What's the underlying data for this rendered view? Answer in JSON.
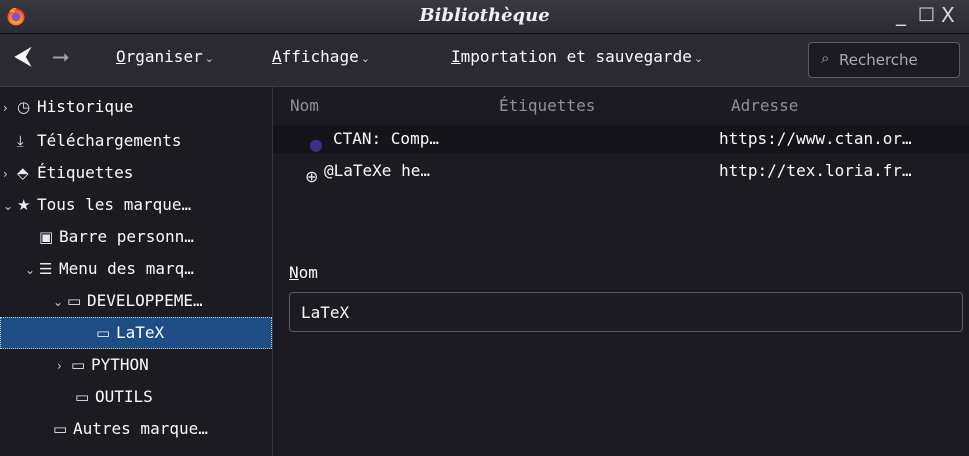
{
  "window": {
    "title": "Bibliothèque",
    "controls": {
      "minimize": "_",
      "maximize": "□",
      "close": "X"
    }
  },
  "toolbar": {
    "back": "⮜",
    "forward": "⭢",
    "organiser_prefix": "O",
    "organiser_rest": "rganiser",
    "affichage_prefix": "A",
    "affichage_rest": "ffichage",
    "import_prefix": "I",
    "import_rest": "mportation et sauvegarde",
    "caret": "⌄",
    "search_placeholder": "Recherche",
    "search_icon": "⌕"
  },
  "sidebar": {
    "items": [
      {
        "twisty": "›",
        "icon": "◷",
        "label": "Historique"
      },
      {
        "twisty": "",
        "icon": "⤓",
        "label": "Téléchargements"
      },
      {
        "twisty": "›",
        "icon": "⬘",
        "label": "Étiquettes"
      },
      {
        "twisty": "⌄",
        "icon": "★",
        "label": "Tous les marque…"
      },
      {
        "twisty": "",
        "icon": "▣",
        "label": "Barre personn…"
      },
      {
        "twisty": "⌄",
        "icon": "☰",
        "label": "Menu des marq…"
      },
      {
        "twisty": "⌄",
        "icon": "▭",
        "label": "DEVELOPPEME…"
      },
      {
        "twisty": "",
        "icon": "▭",
        "label": "LaTeX"
      },
      {
        "twisty": "›",
        "icon": "▭",
        "label": "PYTHON"
      },
      {
        "twisty": "",
        "icon": "▭",
        "label": "OUTILS"
      },
      {
        "twisty": "",
        "icon": "▭",
        "label": "Autres marque…"
      }
    ]
  },
  "table": {
    "columns": {
      "name": "Nom",
      "tags": "Étiquettes",
      "address": "Adresse"
    },
    "rows": [
      {
        "icon": "●",
        "name": "CTAN: Comp…",
        "tags": "",
        "address": "https://www.ctan.or…"
      },
      {
        "icon": "⊕",
        "name": "@LaTeXe he…",
        "tags": "",
        "address": "http://tex.loria.fr…"
      }
    ]
  },
  "details": {
    "name_label_prefix": "N",
    "name_label_rest": "om",
    "name_value": "LaTeX"
  },
  "colors": {
    "selection": "#1e4c84",
    "background": "#1c1b22",
    "toolbar": "#2b2a33"
  }
}
